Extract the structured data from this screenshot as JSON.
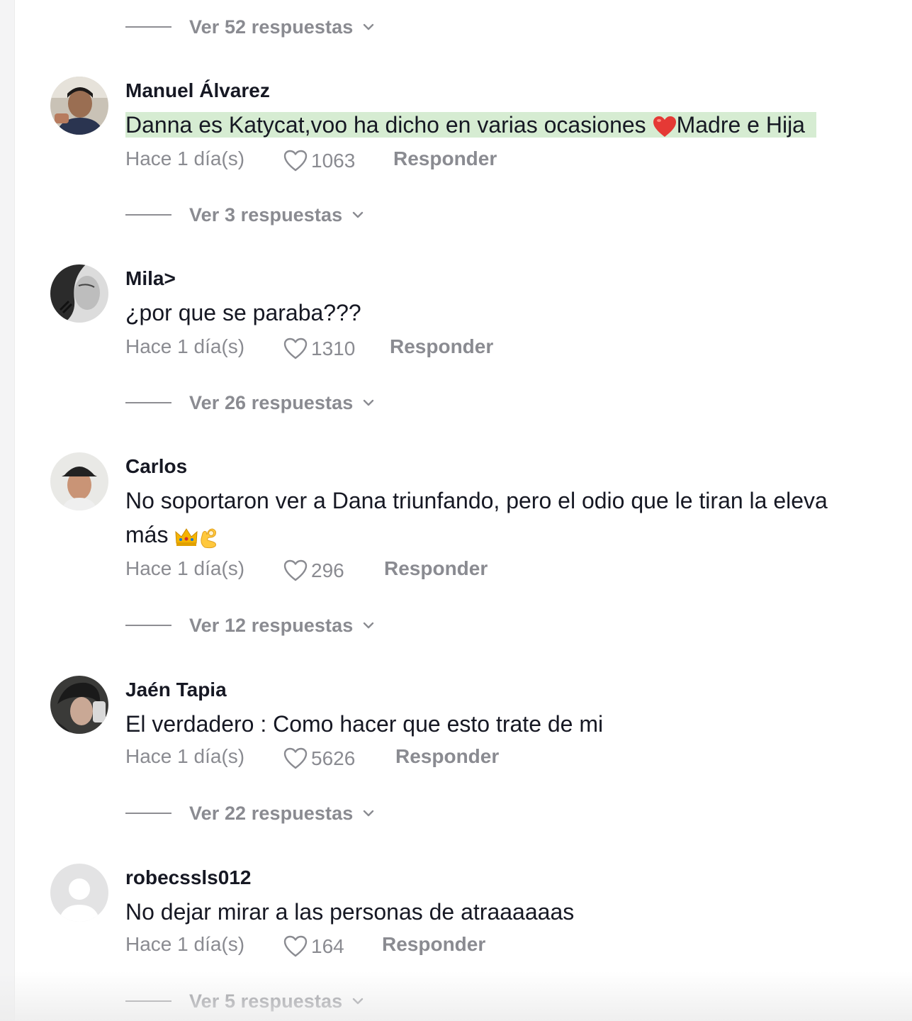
{
  "replies_label_suffix": "respuestas",
  "top_replies": {
    "label": "Ver 52 respuestas"
  },
  "comments": [
    {
      "username": "Manuel Álvarez",
      "text_before": "Danna es Katycat,voo ha dicho en varias ocasiones ",
      "emoji_1": "heart-emoji",
      "text_after": "Madre e Hija",
      "highlighted": true,
      "date": "Hace 1 día(s)",
      "likes": "1063",
      "reply_label": "Responder",
      "replies_label": "Ver 3 respuestas"
    },
    {
      "username": "Mila>",
      "text": "¿por que se paraba???",
      "date": "Hace 1 día(s)",
      "likes": "1310",
      "reply_label": "Responder",
      "replies_label": "Ver 26 respuestas"
    },
    {
      "username": "Carlos",
      "text_line1": "No soportaron ver a Dana triunfando, pero el odio que le tiran la eleva",
      "text_line2": "más ",
      "emojis": [
        "crown-emoji",
        "ok-hand-emoji"
      ],
      "date": "Hace 1 día(s)",
      "likes": "296",
      "reply_label": "Responder",
      "replies_label": "Ver 12 respuestas"
    },
    {
      "username": "Jaén Tapia",
      "text": "El verdadero : Como hacer que esto trate de mi",
      "date": "Hace 1 día(s)",
      "likes": "5626",
      "reply_label": "Responder",
      "replies_label": "Ver 22 respuestas"
    },
    {
      "username": "robecssls012",
      "text": "No dejar mirar a las personas de atraaaaaas",
      "date": "Hace 1 día(s)",
      "likes": "164",
      "reply_label": "Responder",
      "replies_label": "Ver 5 respuestas"
    }
  ],
  "colors": {
    "text_primary": "#161823",
    "text_secondary": "#8a8b91",
    "highlight": "#d6ecd2"
  }
}
